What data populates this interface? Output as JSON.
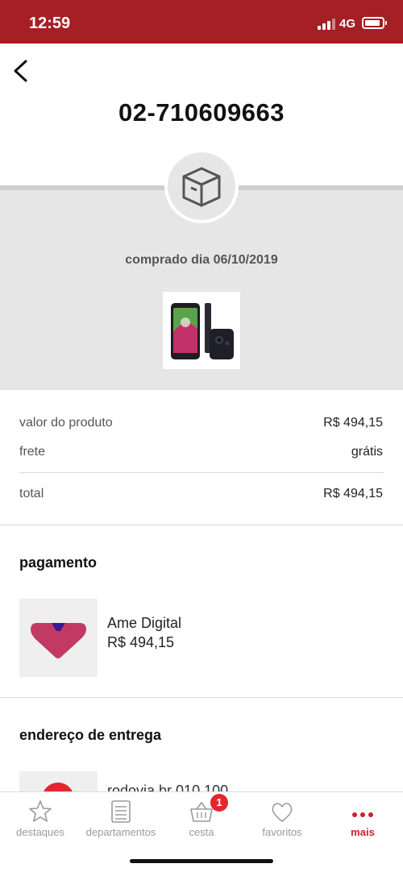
{
  "status_bar": {
    "time": "12:59",
    "network": "4G"
  },
  "header": {
    "order_number": "02-710609663"
  },
  "order": {
    "purchase_date": "comprado dia 06/10/2019"
  },
  "summary": {
    "product_value_label": "valor do produto",
    "product_value": "R$ 494,15",
    "shipping_label": "frete",
    "shipping_value": "grátis",
    "total_label": "total",
    "total_value": "R$ 494,15"
  },
  "payment": {
    "title": "pagamento",
    "method": "Ame Digital",
    "amount": "R$ 494,15"
  },
  "delivery": {
    "title": "endereço de entrega",
    "address_partial": "rodovia br  010  100"
  },
  "tab_bar": {
    "items": [
      {
        "label": "destaques",
        "icon": "star-icon"
      },
      {
        "label": "departamentos",
        "icon": "list-icon"
      },
      {
        "label": "cesta",
        "icon": "basket-icon",
        "badge": "1"
      },
      {
        "label": "favoritos",
        "icon": "heart-icon"
      },
      {
        "label": "mais",
        "icon": "more-dots-icon",
        "active": true
      }
    ]
  },
  "colors": {
    "brand_red": "#a51f24",
    "accent_red": "#d11f2a",
    "hero_gray": "#e6e6e6"
  }
}
